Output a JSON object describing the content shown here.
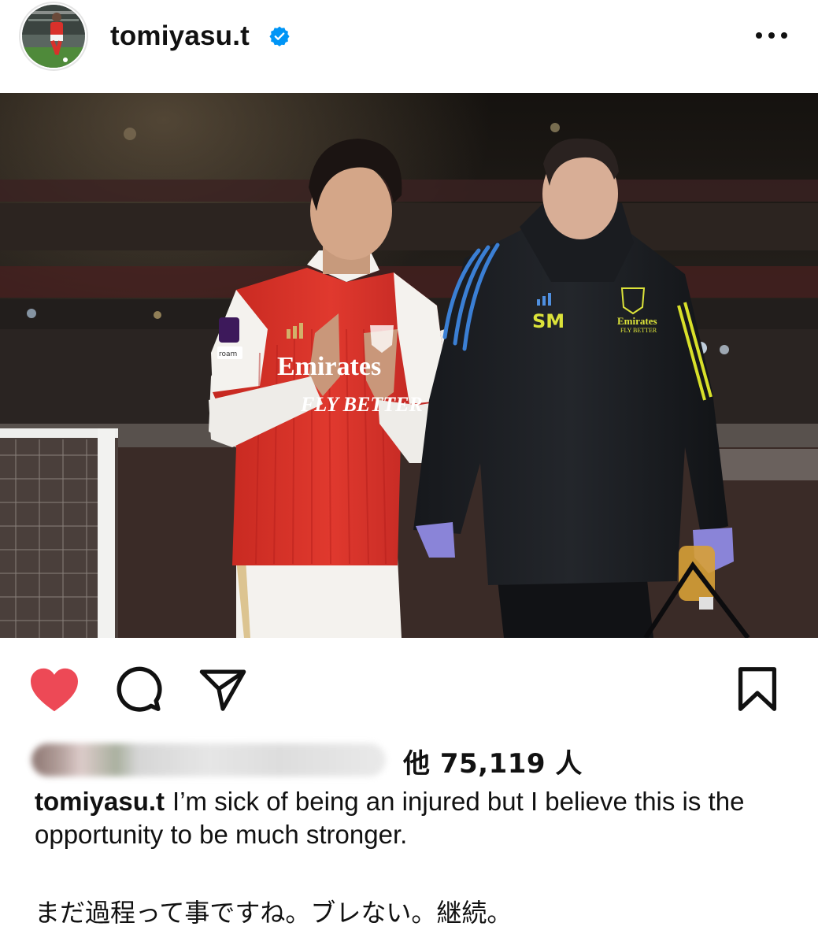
{
  "post": {
    "username": "tomiyasu.t",
    "more_icon": "more-horizontal-icon",
    "verified_icon": "verified-badge-icon",
    "likes_text": "他 75,119 人",
    "caption_username": "tomiyasu.t",
    "caption_text": "I’m sick of being an injured but I believe this is the opportunity to be much stronger.",
    "caption_jp": "まだ過程って事ですね。ブレない。継続。",
    "liked": true
  },
  "photo": {
    "jersey_sponsor_line1": "Emirates",
    "jersey_sponsor_line2": "FLY BETTER",
    "jacket_initials": "SM",
    "jacket_sponsor_line1": "Emirates",
    "jacket_sponsor_line2": "FLY BETTER",
    "badge_text": "roam"
  },
  "colors": {
    "like_red": "#ed4956",
    "verified_blue": "#0095f6",
    "arsenal_red": "#d9312b"
  }
}
